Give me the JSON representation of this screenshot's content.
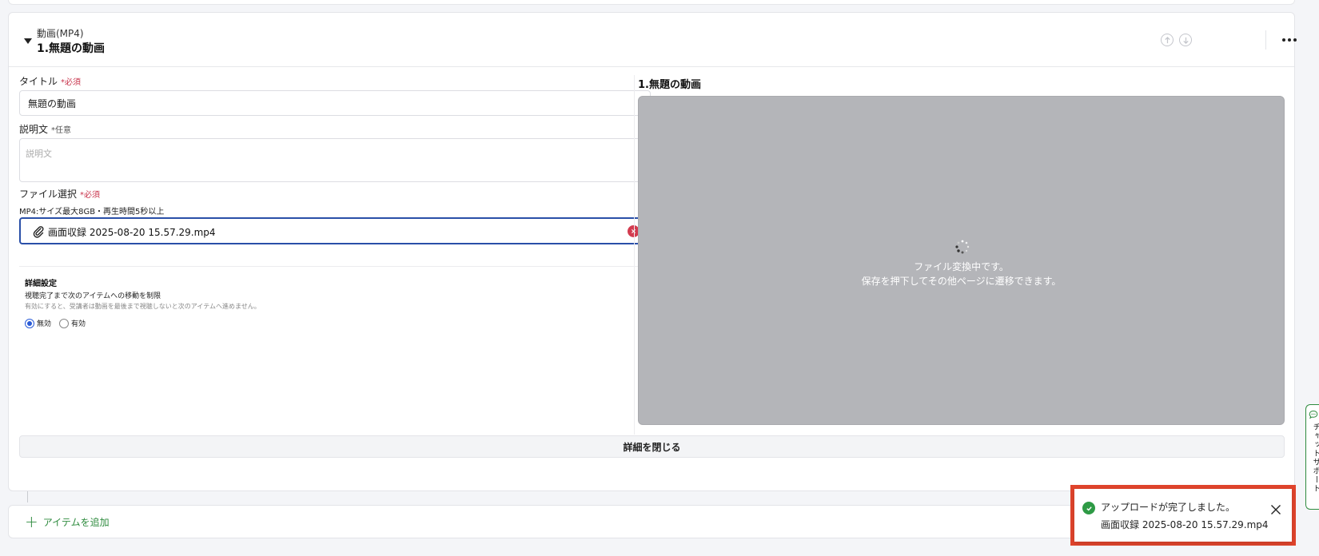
{
  "item": {
    "type_label": "動画(MP4)",
    "title": "1.無題の動画",
    "more_label": "..."
  },
  "form": {
    "title_label": "タイトル",
    "required": "*必須",
    "optional": "*任意",
    "title_value": "無題の動画",
    "desc_label": "説明文",
    "desc_placeholder": "説明文",
    "file_label": "ファイル選択",
    "file_hint": "MP4:サイズ最大8GB・再生時間5秒以上",
    "file_name": "画面収録 2025-08-20 15.57.29.mp4"
  },
  "advanced": {
    "title": "詳細設定",
    "subtitle": "視聴完了まで次のアイテムへの移動を制限",
    "description": "有効にすると、受講者は動画を最後まで視聴しないと次のアイテムへ進めません。",
    "options": [
      {
        "label": "無効",
        "selected": true
      },
      {
        "label": "有効",
        "selected": false
      }
    ]
  },
  "preview": {
    "title": "1.無題の動画",
    "status_line1": "ファイル変換中です。",
    "status_line2": "保存を押下してその他ページに遷移できます。"
  },
  "close_details_label": "詳細を閉じる",
  "add_item_label": "アイテムを追加",
  "chat_support_label": "チャットサポート",
  "toast": {
    "message": "アップロードが完了しました。",
    "file_name": "画面収録 2025-08-20 15.57.29.mp4"
  },
  "colors": {
    "accent_blue": "#2a4fa8",
    "required_red": "#c8334b",
    "success_green": "#2e9a45",
    "highlight_frame": "#e0442c"
  }
}
